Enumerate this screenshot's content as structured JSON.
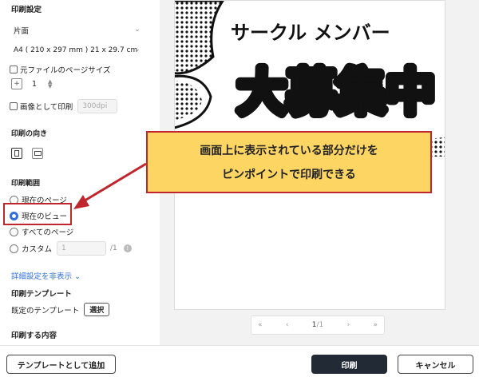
{
  "settings": {
    "print_settings_title": "印刷設定",
    "sides_value": "片面",
    "paper_value": "A4 ( 210 x 297 mm ) 21 x 29.7 cm",
    "original_size_label": "元ファイルのページサイズ",
    "copies_value": "1",
    "print_as_image_label": "画像として印刷",
    "dpi_placeholder": "300dpi",
    "orientation_title": "印刷の向き",
    "range_title": "印刷範囲",
    "range_options": [
      "現在のページ",
      "現在のビュー",
      "すべてのページ",
      "カスタム"
    ],
    "range_selected": "現在のビュー",
    "custom_placeholder": "1",
    "custom_total": "/1",
    "info_glyph": "!",
    "hide_details_link": "詳細設定を非表示",
    "template_title": "印刷テンプレート",
    "template_label": "既定のテンプレート",
    "template_select_button": "選択",
    "content_title": "印刷する内容"
  },
  "preview": {
    "poster_subtitle": "サークル メンバー",
    "poster_headline": "大募集中",
    "pager": {
      "current": "1",
      "total": "/1"
    }
  },
  "callout": {
    "line1": "画面上に表示されている部分だけを",
    "line2": "ピンポイントで印刷できる"
  },
  "footer": {
    "add_template_button": "テンプレートとして追加",
    "print_button": "印刷",
    "cancel_button": "キャンセル"
  },
  "colors": {
    "accent": "#2f6fde",
    "annotation_red": "#c0262d",
    "callout_yellow": "#fdd563",
    "primary_button": "#222a35"
  }
}
